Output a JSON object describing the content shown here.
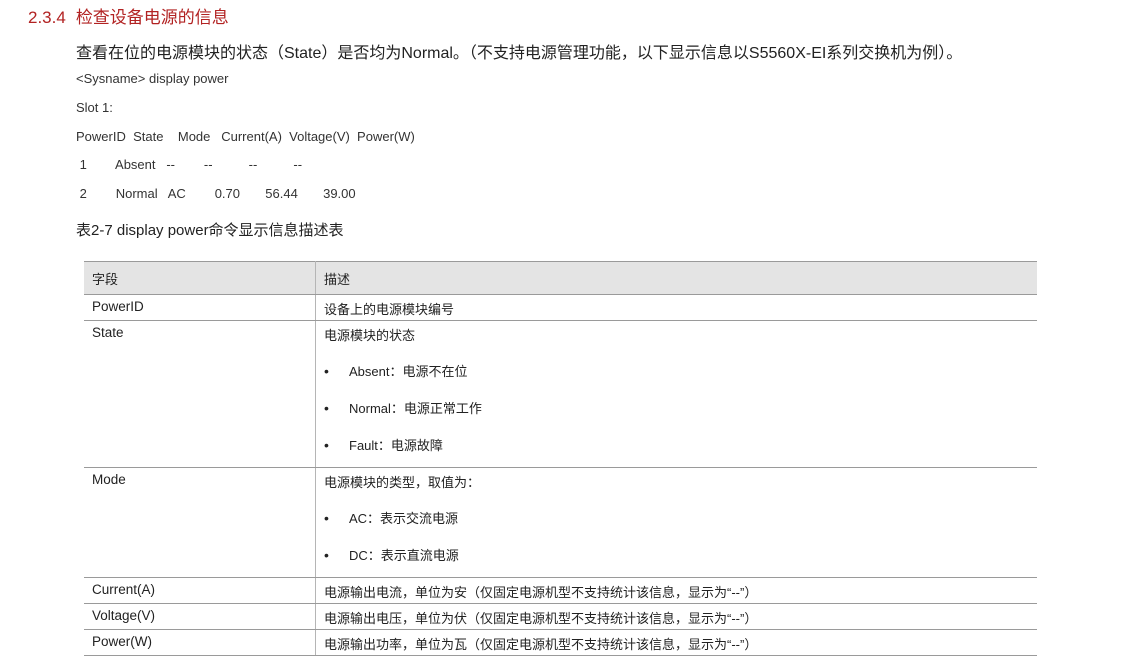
{
  "section": {
    "number": "2.3.4",
    "title": "检查设备电源的信息"
  },
  "intro": "查看在位的电源模块的状态（State）是否均为Normal。（不支持电源管理功能，以下显示信息以S5560X-EI系列交换机为例）。",
  "command_output": [
    "<Sysname> display power",
    "Slot 1:",
    "PowerID  State    Mode   Current(A)  Voltage(V)  Power(W)",
    " 1        Absent   --        --          --          --",
    " 2        Normal   AC        0.70       56.44       39.00"
  ],
  "table": {
    "caption": "表2-7 display power命令显示信息描述表",
    "headers": [
      "字段",
      "描述"
    ],
    "rows": [
      {
        "field": "PowerID",
        "desc": "设备上的电源模块编号",
        "options": []
      },
      {
        "field": "State",
        "desc": "电源模块的状态",
        "options": [
          "Absent：电源不在位",
          "Normal：电源正常工作",
          "Fault：电源故障"
        ]
      },
      {
        "field": "Mode",
        "desc": "电源模块的类型，取值为：",
        "options": [
          "AC：表示交流电源",
          "DC：表示直流电源"
        ]
      },
      {
        "field": "Current(A)",
        "desc": "电源输出电流，单位为安（仅固定电源机型不支持统计该信息，显示为“--”）",
        "options": []
      },
      {
        "field": "Voltage(V)",
        "desc": "电源输出电压，单位为伏（仅固定电源机型不支持统计该信息，显示为“--”）",
        "options": []
      },
      {
        "field": "Power(W)",
        "desc": "电源输出功率，单位为瓦（仅固定电源机型不支持统计该信息，显示为“--”）",
        "options": []
      }
    ]
  }
}
